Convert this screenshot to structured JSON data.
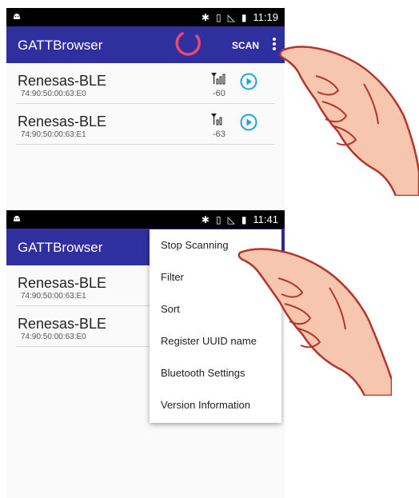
{
  "top_screen": {
    "status_time": "11:19",
    "app_title": "GATTBrowser",
    "scan_label": "SCAN",
    "devices": [
      {
        "name": "Renesas-BLE",
        "address": "74:90:50:00:63:E0",
        "rssi": "-60"
      },
      {
        "name": "Renesas-BLE",
        "address": "74:90:50:00:63:E1",
        "rssi": "-63"
      }
    ]
  },
  "bottom_screen": {
    "status_time": "11:41",
    "app_title": "GATTBrowser",
    "devices": [
      {
        "name": "Renesas-BLE",
        "address": "74:90:50:00:63:E1"
      },
      {
        "name": "Renesas-BLE",
        "address": "74:90:50:00:63:E0"
      }
    ],
    "menu_items": [
      "Stop Scanning",
      "Filter",
      "Sort",
      "Register UUID name",
      "Bluetooth Settings",
      "Version Information"
    ]
  },
  "icons": {
    "status_bar": [
      "android-icon",
      "bluetooth-icon",
      "vibrate-icon",
      "no-sim-icon",
      "battery-icon"
    ],
    "device_row": [
      "signal-strength-icon",
      "connect-arrow-icon"
    ],
    "pointer": "pointing-hand-icon"
  },
  "colors": {
    "app_bar": "#2f2fa0",
    "spinner": "#e84a6f",
    "connect_icon": "#1aa3e0"
  }
}
